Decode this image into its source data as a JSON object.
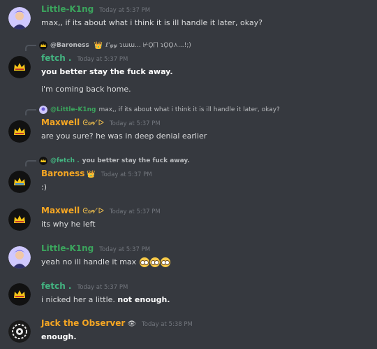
{
  "colors": {
    "little_k1ng": "#3ba55d",
    "fetch": "#43b581",
    "maxwell": "#f5a623",
    "baroness": "#f5a623",
    "observer": "#f5a623",
    "background": "#36393f",
    "timestamp": "#72767d"
  },
  "messages": [
    {
      "author": "Little-K1ng",
      "time": "Today at 5:37 PM",
      "text": "max,, if its about what i think it is ill handle it later, okay?"
    },
    {
      "reply": {
        "author": "@Baroness",
        "badge": "👑",
        "text": "ℓ'𝓎𝓎 ɿɯɯ... ⊬Ϙ⨅ ɿϘϘ⋏...!;)"
      },
      "author": "fetch .",
      "time": "Today at 5:37 PM",
      "lines": [
        "you better stay the fuck away.",
        "i'm coming back home."
      ]
    },
    {
      "reply": {
        "author": "@Little-K1ng",
        "text": "max,, if its about what i think it is ill handle it later, okay?"
      },
      "author": "Maxwell",
      "glyph": "ᘓᔕ̶̶ᐟᐅ",
      "time": "Today at 5:37 PM",
      "text": "are you sure? he was in deep denial earlier"
    },
    {
      "reply": {
        "author": "@fetch .",
        "text": "you better stay the fuck away."
      },
      "author": "Baroness",
      "badge": "👑",
      "time": "Today at 5:37 PM",
      "text": ":)"
    },
    {
      "author": "Maxwell",
      "glyph": "ᘓᔕ̶̶ᐟᐅ",
      "time": "Today at 5:37 PM",
      "text": "its why he left"
    },
    {
      "author": "Little-K1ng",
      "time": "Today at 5:37 PM",
      "text": "yeah no ill handle it max",
      "emoji_count": 3
    },
    {
      "author": "fetch .",
      "time": "Today at 5:37 PM",
      "text_plain": "i nicked her a little.",
      "text_bold": "not enough."
    },
    {
      "author": "Jack the Observer",
      "badge": "👁",
      "time": "Today at 5:38 PM",
      "text": "enough."
    }
  ]
}
